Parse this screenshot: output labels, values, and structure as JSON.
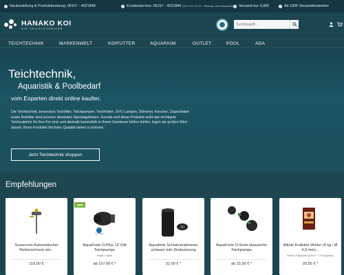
{
  "topbar": {
    "items": [
      {
        "icon": "check-icon",
        "text": "Neubestellung & Produktberatung: 06157 - 4021848"
      },
      {
        "icon": "check-icon",
        "text": "Kundenservice: 06157 - 4021840",
        "small": "(Mo–Fr 8–12 Uhr · Samstag: nach Absprache)"
      },
      {
        "icon": "check-icon",
        "text": "Versand nur 5,90€"
      },
      {
        "icon": "check-icon",
        "text": "Ab 100€ Versandkostenfrei"
      }
    ]
  },
  "header": {
    "logo_title": "HANAKO KOI",
    "logo_subtitle": "DIE TEICHTECHNIKER",
    "search_placeholder": "Suchbegriff...",
    "icons": [
      "search-icon",
      "user-icon",
      "cart-icon"
    ]
  },
  "nav": {
    "items": [
      "TEICHTECHNIK",
      "MARKENWELT",
      "KOIFUTTER",
      "AQUARIUM",
      "OUTLET",
      "POOL",
      "ADA"
    ]
  },
  "hero": {
    "title_line1": "Teichtechnik,",
    "title_line2": "Aquaristik & Poolbedarf",
    "subtitle": "vom Experten direkt online kaufen.",
    "paragraph": "Die Teichtechnik, besonders Teichfilter, Teichpumpen, Teichfolien, UVC-Lampen, Skimmer, Kescher, Zugschieber sowie Koifutter sind unseren absoluten Spezialgebieten. Gerade weil diese Produkte wohl das wichtigste Teichzubehör für Ihre Koi sind, und deshalb keinesfalls in Ihrem Gewässer fehlen dürfen, legen wir großen Wert darauf, Ihnen Produkte höchster Qualität bieten zu können.",
    "button": "Jetzt Teichtechnik shoppen"
  },
  "recommendations": {
    "title": "Empfehlungen",
    "badge": "TIPP",
    "products": [
      {
        "name": "Scarecrow Automatischer Reiherschreck mit...",
        "sub": "",
        "price": "119,00 €"
      },
      {
        "name": "AquaForte O-Plus 12 Volt Teichpumpe",
        "sub": "Inhalt: 1 Stück",
        "price": "ab 157,00 € *"
      },
      {
        "name": "Aquaforte Schwimmskimmer schwarz inkl. Reduzierung",
        "sub": "",
        "price": "32,00 € *"
      },
      {
        "name": "AquaForte O-Serie klassische Teichpumpe",
        "sub": "",
        "price": "ab 15,90 € *"
      },
      {
        "name": "Alkote Koifutter Winter (4 kg / Ø 4,5 mm)...",
        "sub": "Inhalt: 4 Kilogramm (6,64 € * / 1 Kilogramm)",
        "price": "26,55 € *"
      }
    ]
  },
  "colors": {
    "background": "#1d4651",
    "topbar": "#143741",
    "badge": "#7cb13a"
  }
}
